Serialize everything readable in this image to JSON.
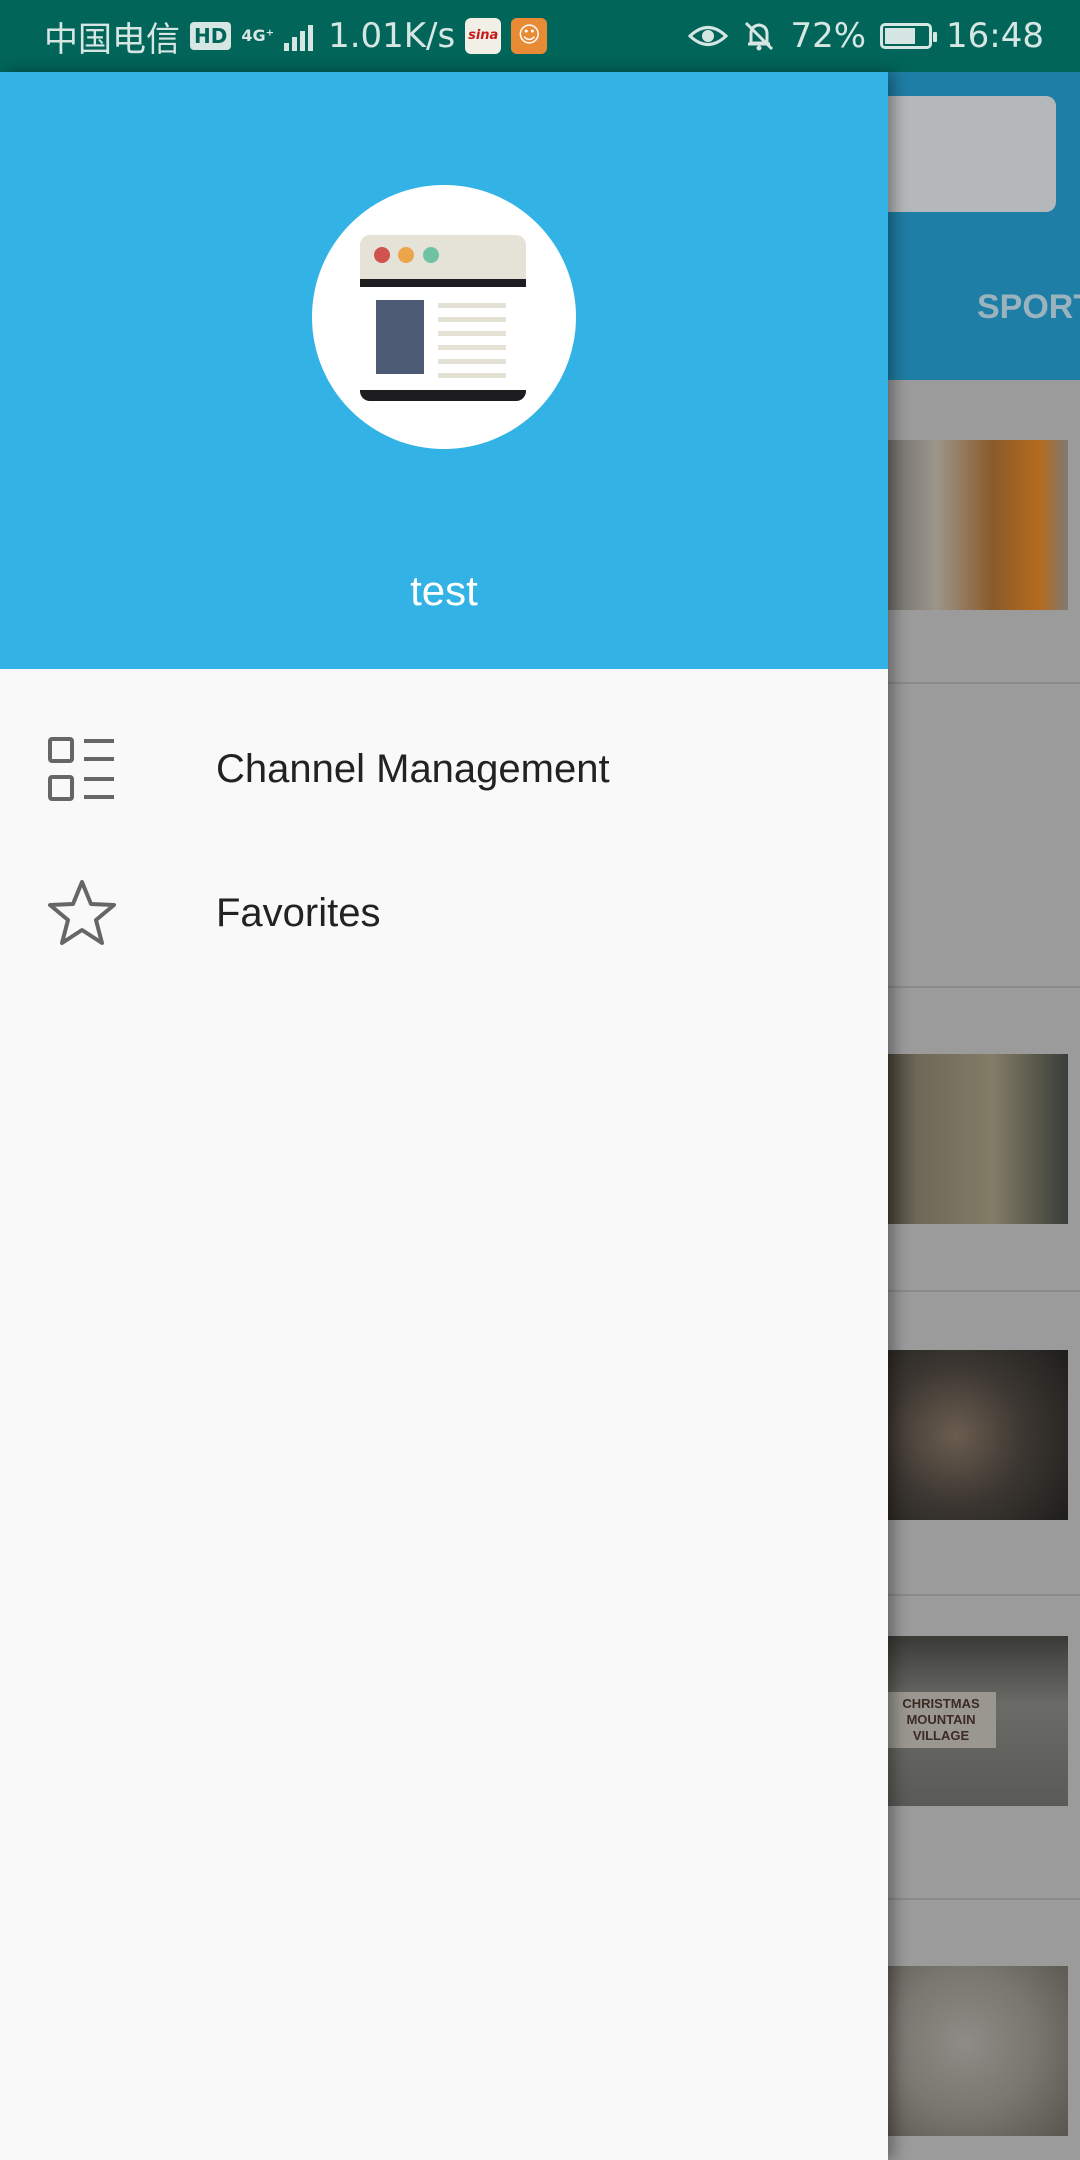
{
  "status_bar": {
    "carrier": "中国电信",
    "hd_badge": "HD",
    "network": "4G⁺",
    "speed": "1.01K/s",
    "app_icons": [
      "sina",
      "uc"
    ],
    "battery_percent": "72%",
    "battery_level": 0.72,
    "time": "16:48"
  },
  "background_app": {
    "visible_tab": "SPORT",
    "thumb_sign_text": "CHRISTMAS MOUNTAIN VILLAGE"
  },
  "drawer": {
    "header": {
      "background": "#33b3e5",
      "avatar_icon": "browser-window-icon",
      "user_name": "test"
    },
    "menu": [
      {
        "label": "Channel Management",
        "icon": "checklist-icon"
      },
      {
        "label": "Favorites",
        "icon": "star-icon"
      }
    ]
  }
}
